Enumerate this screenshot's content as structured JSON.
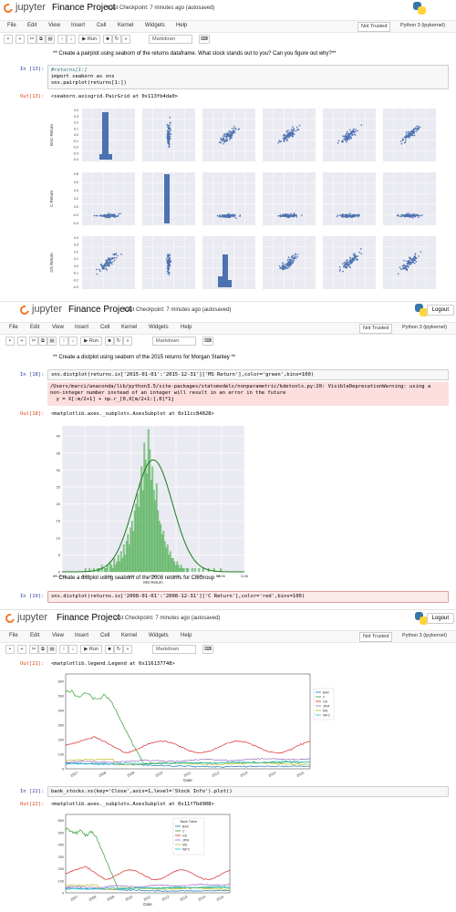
{
  "header": {
    "app_name": "jupyter",
    "notebook_title": "Finance Project",
    "checkpoint": "Last Checkpoint: 7 minutes ago (autosaved)",
    "logout_label": "Logout"
  },
  "menu": {
    "items": [
      "File",
      "Edit",
      "View",
      "Insert",
      "Cell",
      "Kernel",
      "Widgets",
      "Help"
    ],
    "kernel_status": "Not Trusted",
    "kernel_name": "Python 3 (ipykernel)"
  },
  "toolbar": {
    "run_label": "Run",
    "cell_type": "Markdown",
    "icons": [
      "save-icon",
      "plus-icon",
      "cut-icon",
      "copy-icon",
      "paste-icon",
      "arrow-up-icon",
      "arrow-down-icon",
      "run-icon",
      "stop-icon",
      "restart-icon",
      "fast-forward-icon",
      "keyboard-icon"
    ]
  },
  "cells": {
    "pairplot_md": "** Create a pairplot using seaborn of the returns dataframe. What stock stands out to you? Can you figure out why?**",
    "in13_prompt": "In [13]:",
    "in13_code_l1": "#returns[1:]",
    "in13_code_l2": "import seaborn as sns",
    "in13_code_l3": "sns.pairplot(returns[1:])",
    "out13_prompt": "Out[13]:",
    "out13_text": "<seaborn.axisgrid.PairGrid at 0x113fb4da0>",
    "ms_md": "** Create a distplot using seaborn of the 2015 returns for Morgan Stanley **",
    "in18_prompt": "In [18]:",
    "in18_code": "sns.distplot(returns.ix['2015-01-01':'2015-12-31']['MS Return'],color='green',bins=100)",
    "warning_l1": "/Users/marci/anaconda/lib/python3.5/site-packages/statsmodels/nonparametric/kdetools.py:20: VisibleDeprecationWarning: using a",
    "warning_l2": "non-integer number instead of an integer will result in an error in the future",
    "warning_l3": "  y = X[:m/2+1] + np.r_[0,X[m/2+1:],0]*1j",
    "out18_prompt": "Out[18]:",
    "out18_text": "<matplotlib.axes._subplots.AxesSubplot at 0x11cc84828>",
    "citi_md": "** Create a distplot using seaborn of the 2008 returns for CitiGroup **",
    "in19_prompt": "In [19]:",
    "in19_code": "sns.distplot(returns.ix['2008-01-01':'2008-12-31']['C Return'],color='red',bins=100)",
    "out21_prompt": "Out[21]:",
    "out21_text": "<matplotlib.legend.Legend at 0x116137748>",
    "in22_prompt": "In [22]:",
    "in22_code": "bank_stocks.xs(key='Close',axis=1,level='Stock Info').plot()",
    "out22_prompt": "Out[22]:",
    "out22_text": "<matplotlib.axes._subplots.AxesSubplot at 0x11f7bd908>"
  },
  "chart_data": [
    {
      "type": "scatter",
      "name": "pairplot",
      "row_labels": [
        "BAC Return",
        "C Return",
        "GS Return"
      ],
      "yticks": {
        "BAC Return": [
          "0.4",
          "0.3",
          "0.2",
          "0.1",
          "0.0",
          "-0.1",
          "-0.2",
          "-0.3",
          "-0.4"
        ],
        "C Return": [
          "0.8",
          "0.6",
          "0.4",
          "0.2",
          "0.0",
          "-0.2",
          "-0.4"
        ],
        "GS Return": [
          "0.4",
          "0.3",
          "0.2",
          "0.1",
          "0.0",
          "-0.1",
          "-0.2",
          "-0.3"
        ]
      },
      "color": "#4c72b0",
      "background": "#eaeaf2"
    },
    {
      "type": "bar",
      "name": "ms_return_distplot",
      "xlabel": "MS Return",
      "x_ticks": [
        "-0.08",
        "-0.06",
        "-0.04",
        "-0.02",
        "0.00",
        "0.02",
        "0.04",
        "0.06",
        "0.08"
      ],
      "y_ticks": [
        "0",
        "5",
        "10",
        "15",
        "20",
        "25",
        "30",
        "35",
        "40"
      ],
      "xlim": [
        -0.08,
        0.08
      ],
      "ylim": [
        0,
        43
      ],
      "bin_start": -0.06,
      "bin_width": 0.0012,
      "values": [
        1,
        0,
        0,
        1,
        0,
        0,
        1,
        0,
        0,
        1,
        1,
        0,
        2,
        0,
        1,
        1,
        2,
        0,
        3,
        2,
        1,
        4,
        2,
        3,
        5,
        3,
        6,
        4,
        8,
        5,
        9,
        11,
        8,
        13,
        15,
        12,
        18,
        20,
        23,
        19,
        26,
        31,
        24,
        38,
        33,
        29,
        42,
        36,
        27,
        31,
        24,
        21,
        26,
        18,
        15,
        14,
        11,
        12,
        9,
        7,
        8,
        5,
        6,
        4,
        4,
        3,
        2,
        3,
        2,
        1,
        2,
        1,
        1,
        0,
        1,
        1,
        0,
        0,
        1,
        0,
        1,
        0,
        0,
        1,
        0,
        0,
        1,
        0,
        0,
        0,
        1,
        0,
        0,
        0,
        1,
        0,
        0,
        0,
        0,
        1
      ],
      "kde_peak": 33,
      "kde_sd": 0.017,
      "bar_color": "#4caf50",
      "kde_color": "#1b7a1b"
    },
    {
      "type": "line",
      "name": "close_prices_legend",
      "xlabel": "Date",
      "x_ticks": [
        "2007",
        "2008",
        "2009",
        "2010",
        "2011",
        "2012",
        "2013",
        "2014",
        "2015"
      ],
      "y_ticks": [
        "0",
        "100",
        "200",
        "300",
        "400",
        "500",
        "600"
      ],
      "ylim": [
        0,
        650
      ],
      "legend": [
        "BAC",
        "C",
        "GS",
        "JPM",
        "MS",
        "WFC"
      ],
      "legend_position": "right",
      "series_colors": [
        "#1f77b4",
        "#2ca02c",
        "#d62728",
        "#9467bd",
        "#bcbd22",
        "#17becf"
      ]
    },
    {
      "type": "line",
      "name": "close_prices_bank_ticker",
      "xlabel": "Date",
      "legend_title": "Bank Ticker",
      "x_ticks": [
        "2007",
        "2008",
        "2009",
        "2010",
        "2011",
        "2012",
        "2013",
        "2014",
        "2015"
      ],
      "y_ticks": [
        "0",
        "100",
        "200",
        "300",
        "400",
        "500",
        "600"
      ],
      "ylim": [
        0,
        650
      ],
      "legend": [
        "BAC",
        "C",
        "GS",
        "JPM",
        "MS",
        "WFC"
      ],
      "legend_position": "top-right",
      "series_colors": [
        "#1f77b4",
        "#2ca02c",
        "#d62728",
        "#9467bd",
        "#bcbd22",
        "#17becf"
      ]
    }
  ]
}
